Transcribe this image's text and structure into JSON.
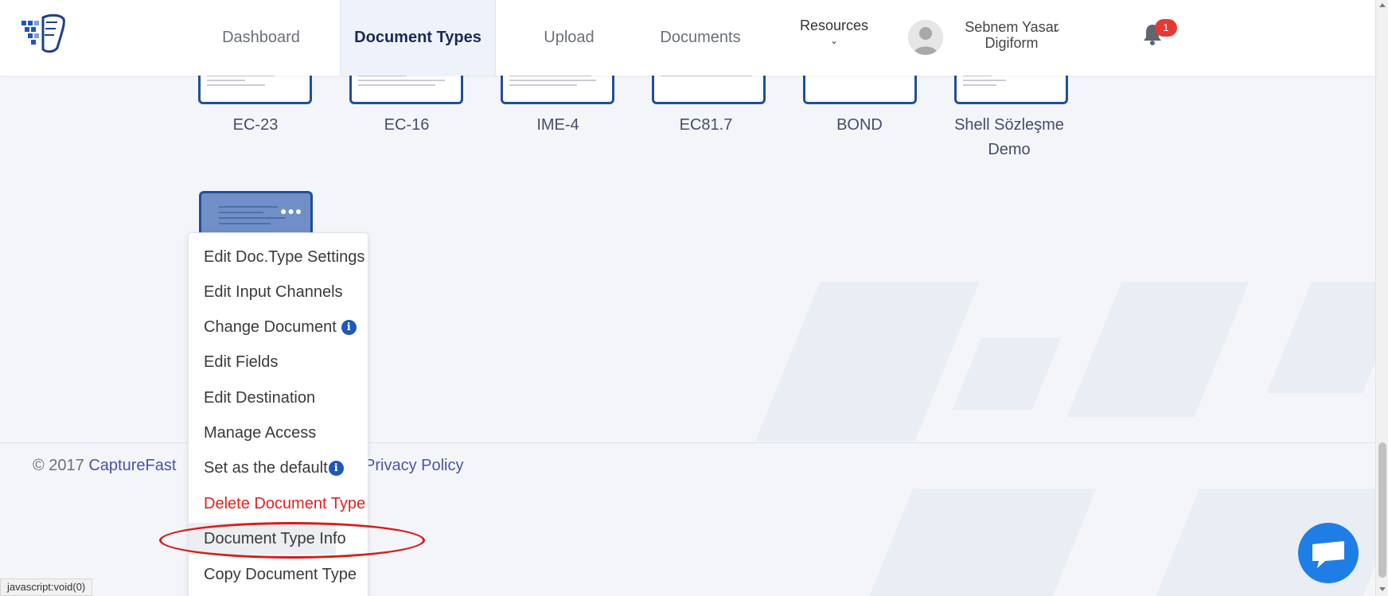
{
  "header": {
    "nav": [
      "Dashboard",
      "Document Types",
      "Upload",
      "Documents"
    ],
    "resources": "Resources",
    "user": {
      "name": "Sebnem Yasar",
      "company": "Digiform"
    },
    "notification_count": "1"
  },
  "document_types": [
    "EC-23",
    "EC-16",
    "IME-4",
    "EC81.7",
    "BOND",
    "Shell Sözleşme Demo"
  ],
  "context_menu": [
    "Edit Doc.Type Settings",
    "Edit Input Channels",
    "Change Document",
    "Edit Fields",
    "Edit Destination",
    "Manage Access",
    "Set as the default",
    "Delete Document Type",
    "Document Type Info",
    "Copy Document Type"
  ],
  "footer": {
    "copyright": "© 2017",
    "brand": "CaptureFast",
    "privacy": "Privacy Policy"
  },
  "status_bar": "javascript:void(0)",
  "colors": {
    "accent": "#1f4f9a",
    "danger": "#e02424",
    "highlight_ring": "#d81b1b",
    "chat": "#1f7ee6"
  }
}
